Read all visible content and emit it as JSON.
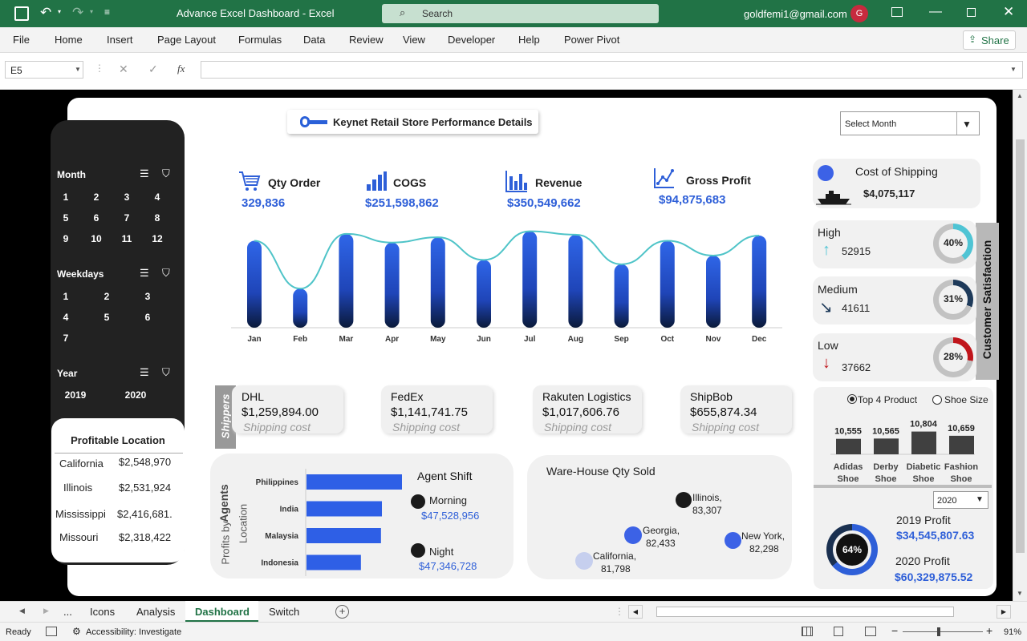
{
  "window": {
    "title": "Advance Excel Dashboard  -  Excel",
    "search": "Search",
    "user": "goldfemi1@gmail.com",
    "avatar": "G"
  },
  "ribbon": {
    "tabs": [
      "File",
      "Home",
      "Insert",
      "Page Layout",
      "Formulas",
      "Data",
      "Review",
      "View",
      "Developer",
      "Help",
      "Power Pivot"
    ],
    "share": "Share"
  },
  "formula": {
    "namebox": "E5",
    "fx": "fx"
  },
  "dashboard": {
    "title": "Keynet Retail Store Performance Details",
    "select_month": "Select Month",
    "slicers": {
      "month": {
        "title": "Month",
        "items": [
          "1",
          "2",
          "3",
          "4",
          "5",
          "6",
          "7",
          "8",
          "9",
          "10",
          "11",
          "12"
        ]
      },
      "weekdays": {
        "title": "Weekdays",
        "items": [
          "1",
          "2",
          "3",
          "4",
          "5",
          "6",
          "7"
        ]
      },
      "year": {
        "title": "Year",
        "items": [
          "2019",
          "2020"
        ]
      }
    },
    "kpis": [
      {
        "label": "Qty Order",
        "value": "329,836",
        "icon": "cart-icon"
      },
      {
        "label": "COGS",
        "value": "$251,598,862",
        "icon": "bar-chart-icon"
      },
      {
        "label": "Revenue",
        "value": "$350,549,662",
        "icon": "revenue-chart-icon"
      },
      {
        "label": "Gross Profit",
        "value": "$94,875,683",
        "icon": "line-chart-icon"
      }
    ],
    "shippers_label": "Shippers",
    "shippers": [
      {
        "name": "DHL",
        "value": "$1,259,894.00",
        "sub": "Shipping cost"
      },
      {
        "name": "FedEx",
        "value": "$1,141,741.75",
        "sub": "Shipping cost"
      },
      {
        "name": "Rakuten Logistics",
        "value": "$1,017,606.76",
        "sub": "Shipping cost"
      },
      {
        "name": "ShipBob",
        "value": "$655,874.34",
        "sub": "Shipping cost"
      }
    ],
    "profitable": {
      "title": "Profitable Location",
      "rows": [
        {
          "state": "California",
          "value": "$2,548,970"
        },
        {
          "state": "Illinois",
          "value": "$2,531,924"
        },
        {
          "state": "Mississippi",
          "value": "$2,416,681."
        },
        {
          "state": "Missouri",
          "value": "$2,318,422"
        }
      ]
    },
    "agents": {
      "axis1": "Agents",
      "axis2": "Profits by",
      "axis3": "Location",
      "shift_title": "Agent Shift",
      "shifts": [
        {
          "name": "Morning",
          "value": "$47,528,956"
        },
        {
          "name": "Night",
          "value": "$47,346,728"
        }
      ]
    },
    "warehouse": {
      "title": "Ware-House Qty Sold",
      "points": [
        {
          "label": "Illinois,",
          "value": "83,307"
        },
        {
          "label": "Georgia,",
          "value": "82,433"
        },
        {
          "label": "New York,",
          "value": "82,298"
        },
        {
          "label": "California,",
          "value": "81,798"
        }
      ]
    },
    "cost_shipping": {
      "label": "Cost of Shipping",
      "value": "$4,075,117"
    },
    "satisfaction": {
      "title": "Customer Satisfaction",
      "items": [
        {
          "level": "High",
          "value": "52915",
          "pct": "40%",
          "frac": 0.4,
          "color": "#4fc4d4"
        },
        {
          "level": "Medium",
          "value": "41611",
          "pct": "31%",
          "frac": 0.31,
          "color": "#1e3a5a"
        },
        {
          "level": "Low",
          "value": "37662",
          "pct": "28%",
          "frac": 0.28,
          "color": "#c0151b"
        }
      ]
    },
    "products": {
      "opt1": "Top 4 Product",
      "opt2": "Shoe Size",
      "items": [
        {
          "name": "Adidas",
          "name2": "Shoe",
          "value": "10,555",
          "v": 10555
        },
        {
          "name": "Derby",
          "name2": "Shoe",
          "value": "10,565",
          "v": 10565
        },
        {
          "name": "Diabetic",
          "name2": "Shoe",
          "value": "10,804",
          "v": 10804
        },
        {
          "name": "Fashion",
          "name2": "Shoe",
          "value": "10,659",
          "v": 10659
        }
      ]
    },
    "profit": {
      "year_select": "2020",
      "pct": "64%",
      "frac": 0.64,
      "p2019_label": "2019 Profit",
      "p2019": "$34,545,807.63",
      "p2020_label": "2020 Profit",
      "p2020": "$60,329,875.52"
    }
  },
  "chart_data": [
    {
      "type": "bar",
      "title": "",
      "categories": [
        "Jan",
        "Feb",
        "Mar",
        "Apr",
        "May",
        "Jun",
        "Jul",
        "Aug",
        "Sep",
        "Oct",
        "Nov",
        "Dec"
      ],
      "values": [
        100,
        45,
        108,
        98,
        104,
        78,
        111,
        107,
        73,
        100,
        83,
        106
      ],
      "line": [
        100,
        45,
        108,
        98,
        104,
        78,
        111,
        107,
        73,
        100,
        83,
        106
      ],
      "ylim": [
        0,
        118
      ],
      "grid": false
    },
    {
      "type": "bar",
      "orientation": "horizontal",
      "title": "",
      "categories": [
        "Philippines",
        "India",
        "Malaysia",
        "Indonesia"
      ],
      "values": [
        100,
        79,
        78,
        57
      ],
      "xlim": [
        0,
        100
      ]
    }
  ],
  "sheet_tabs": {
    "more": "...",
    "tabs": [
      "Icons",
      "Analysis",
      "Dashboard",
      "Switch"
    ],
    "active": "Dashboard"
  },
  "status": {
    "ready": "Ready",
    "accessibility": "Accessibility: Investigate",
    "zoom": "91%"
  }
}
